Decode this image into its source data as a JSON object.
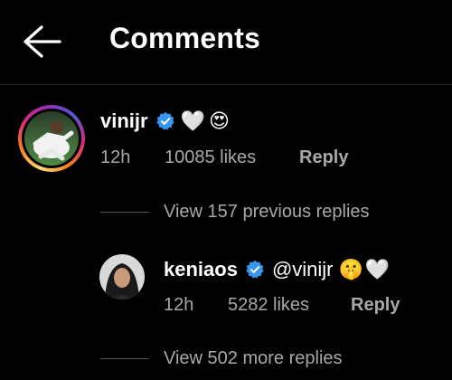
{
  "header": {
    "title": "Comments",
    "back_icon": "arrow-left-icon"
  },
  "comment": {
    "username": "vinijr",
    "verified": true,
    "emojis": [
      "🤍",
      "😍"
    ],
    "time": "12h",
    "likes": "10085 likes",
    "reply_label": "Reply"
  },
  "previous_replies_label": "View 157 previous replies",
  "reply": {
    "username": "keniaos",
    "verified": true,
    "text": "@vinijr",
    "emojis": [
      "🤫",
      "🤍"
    ],
    "time": "12h",
    "likes": "5282 likes",
    "reply_label": "Reply"
  },
  "more_replies_label": "View 502 more replies",
  "colors": {
    "background": "#000000",
    "text": "#ffffff",
    "muted": "#a8a8a8",
    "verified": "#3797f0"
  }
}
